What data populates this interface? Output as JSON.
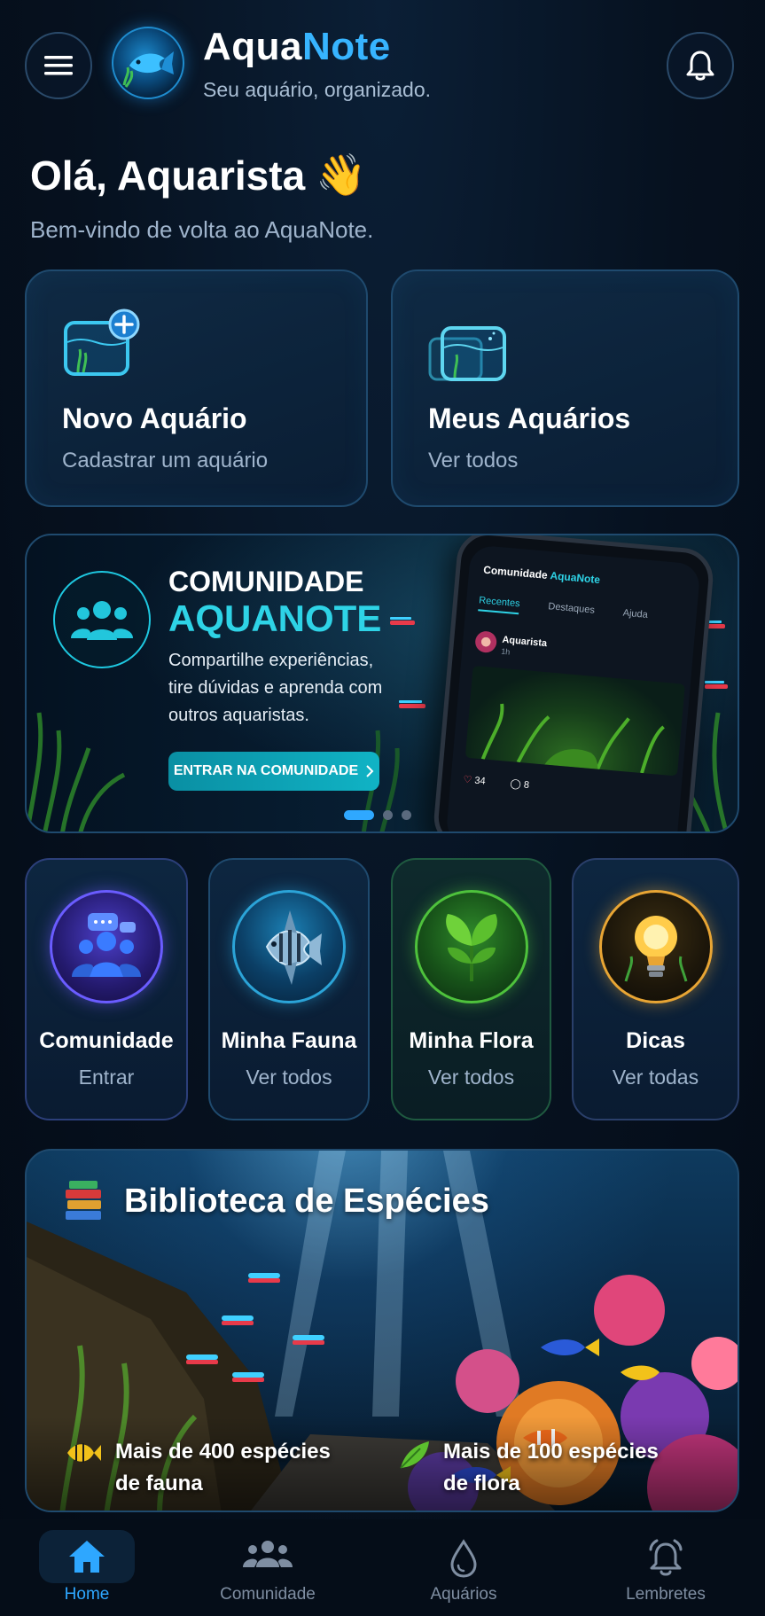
{
  "header": {
    "title_part1": "Aqua",
    "title_part2": "Note",
    "subtitle": "Seu aquário, organizado."
  },
  "greeting": {
    "title": "Olá, Aquarista",
    "emoji": "👋",
    "welcome": "Bem-vindo de volta ao AquaNote."
  },
  "actions": [
    {
      "title": "Novo Aquário",
      "subtitle": "Cadastrar um aquário"
    },
    {
      "title": "Meus Aquários",
      "subtitle": "Ver todos"
    }
  ],
  "community_banner": {
    "title_line1": "COMUNIDADE",
    "title_line2": "AQUANOTE",
    "text": "Compartilhe experiências, tire dúvidas e aprenda com outros aquaristas.",
    "button_label": "ENTRAR NA COMUNIDADE",
    "carousel_total": 3,
    "carousel_active": 1,
    "phone": {
      "header_part1": "Comunidade",
      "header_part2": "AquaNote",
      "tabs": [
        "Recentes",
        "Destaques",
        "Ajuda"
      ],
      "post_user": "Aquarista",
      "post_time": "1h",
      "likes": "34",
      "comments": "8"
    }
  },
  "categories": [
    {
      "title": "Comunidade",
      "subtitle": "Entrar",
      "icon": "community-icon"
    },
    {
      "title": "Minha Fauna",
      "subtitle": "Ver todos",
      "icon": "angelfish-icon"
    },
    {
      "title": "Minha Flora",
      "subtitle": "Ver todos",
      "icon": "plant-icon"
    },
    {
      "title": "Dicas",
      "subtitle": "Ver todas",
      "icon": "lightbulb-icon"
    }
  ],
  "library": {
    "title": "Biblioteca de Espécies",
    "stat_fauna_line1": "Mais de 400 espécies",
    "stat_fauna_line2": "de fauna",
    "stat_flora_line1": "Mais de 100 espécies",
    "stat_flora_line2": "de flora"
  },
  "bottom_nav": [
    {
      "label": "Home",
      "icon": "home-icon",
      "active": true
    },
    {
      "label": "Comunidade",
      "icon": "people-icon",
      "active": false
    },
    {
      "label": "Aquários",
      "icon": "water-drop-icon",
      "active": false
    },
    {
      "label": "Lembretes",
      "icon": "alarm-bell-icon",
      "active": false
    }
  ],
  "colors": {
    "accent": "#37b4ff",
    "teal": "#2ed3e6",
    "background": "#06111f"
  }
}
